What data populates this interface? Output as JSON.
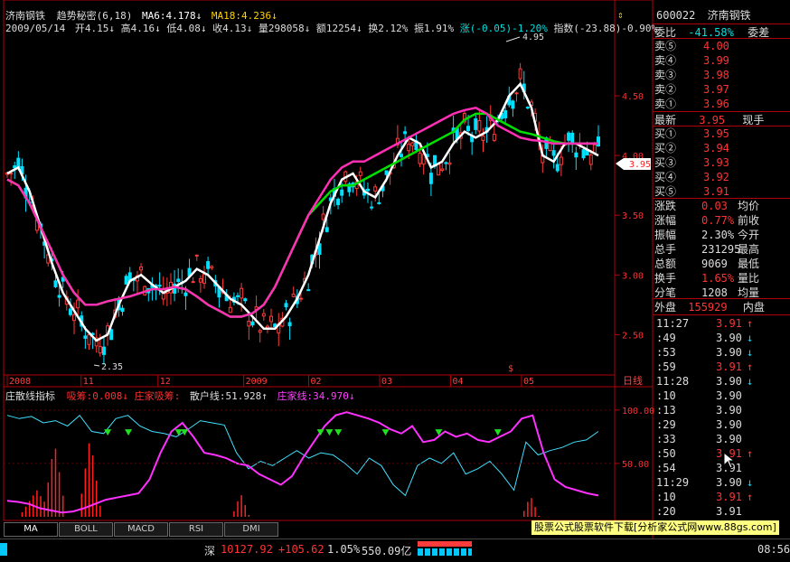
{
  "header": {
    "stock_name": "济南钢铁",
    "indicator_name": "趋势秘密(6,18)",
    "ma6": "MA6:4.178↓",
    "ma18": "MA18:4.236↓",
    "date": "2009/05/14",
    "open": "开4.15↓",
    "high": "高4.16↓",
    "low": "低4.08↓",
    "close": "收4.13↓",
    "volume": "量298058↓",
    "amount": "额12254↓",
    "turnover": "换2.12%",
    "amplitude": "振1.91%",
    "change": "涨(-0.05)-1.20%",
    "index": "指数(-23.88)-0.90%"
  },
  "price_axis": [
    "4.50",
    "4.00",
    "3.50",
    "3.00",
    "2.50"
  ],
  "current_price_tag": "3.95",
  "peak_label": "4.95",
  "trough_label": "2.35",
  "time_axis": [
    "2008",
    "11",
    "12",
    "2009",
    "02",
    "03",
    "04",
    "05"
  ],
  "sub_header": {
    "title": "庄散线指标",
    "accum": "吸筹:0.008↓",
    "dealer_accum": "庄家吸筹:",
    "retail_line": "散户线:51.928↑",
    "dealer_line": "庄家线:34.970↓"
  },
  "sub_axis": [
    "100.00",
    "50.00"
  ],
  "daily_label": "日线",
  "tabs": [
    "MA",
    "BOLL",
    "MACD",
    "RSI",
    "DMI"
  ],
  "watermark": "股票公式股票软件下载[分析家公式网www.88gs.com]",
  "status": {
    "market": "深",
    "index_value": "10127.92",
    "index_change": "+105.62",
    "index_pct": "1.05%",
    "turnover": "550.09亿",
    "time": "08:56"
  },
  "quote": {
    "code": "600022",
    "name": "济南钢铁",
    "commission_ratio_label": "委比",
    "commission_ratio": "-41.58%",
    "commission_diff_label": "委差",
    "asks": [
      {
        "label": "卖⑤",
        "price": "4.00"
      },
      {
        "label": "卖④",
        "price": "3.99"
      },
      {
        "label": "卖③",
        "price": "3.98"
      },
      {
        "label": "卖②",
        "price": "3.97"
      },
      {
        "label": "卖①",
        "price": "3.96"
      }
    ],
    "last_label": "最新",
    "last_price": "3.95",
    "last_vol_label": "现手",
    "bids": [
      {
        "label": "买①",
        "price": "3.95"
      },
      {
        "label": "买②",
        "price": "3.94"
      },
      {
        "label": "买③",
        "price": "3.93"
      },
      {
        "label": "买④",
        "price": "3.92"
      },
      {
        "label": "买⑤",
        "price": "3.91"
      }
    ],
    "stats": [
      {
        "label": "涨跌",
        "value": "0.03",
        "label2": "均价",
        "color": "#ff3333"
      },
      {
        "label": "涨幅",
        "value": "0.77%",
        "label2": "前收",
        "color": "#ff3333"
      },
      {
        "label": "振幅",
        "value": "2.30%",
        "label2": "今开",
        "color": "#dddddd"
      },
      {
        "label": "总手",
        "value": "231295",
        "label2": "最高",
        "color": "#dddddd"
      },
      {
        "label": "总额",
        "value": "9069",
        "label2": "最低",
        "color": "#dddddd"
      },
      {
        "label": "换手",
        "value": "1.65%",
        "label2": "量比",
        "color": "#ff3333"
      },
      {
        "label": "分笔",
        "value": "1208",
        "label2": "均量",
        "color": "#dddddd"
      }
    ],
    "outer_label": "外盘",
    "outer_value": "155929",
    "inner_label": "内盘"
  },
  "ticks": [
    {
      "time": "11:27",
      "price": "3.91",
      "dir": "up"
    },
    {
      "time": ":49",
      "price": "3.90",
      "dir": "down"
    },
    {
      "time": ":53",
      "price": "3.90",
      "dir": "down"
    },
    {
      "time": ":59",
      "price": "3.91",
      "dir": "up"
    },
    {
      "time": "11:28",
      "price": "3.90",
      "dir": "down"
    },
    {
      "time": ":10",
      "price": "3.90",
      "dir": ""
    },
    {
      "time": ":13",
      "price": "3.90",
      "dir": ""
    },
    {
      "time": ":29",
      "price": "3.90",
      "dir": ""
    },
    {
      "time": ":33",
      "price": "3.90",
      "dir": ""
    },
    {
      "time": ":50",
      "price": "3.91",
      "dir": "up"
    },
    {
      "time": ":54",
      "price": "3.91",
      "dir": ""
    },
    {
      "time": "11:29",
      "price": "3.90",
      "dir": "down"
    },
    {
      "time": ":10",
      "price": "3.91",
      "dir": "up"
    },
    {
      "time": ":20",
      "price": "3.91",
      "dir": ""
    }
  ],
  "chart_data": {
    "type": "line",
    "title": "济南钢铁 趋势秘密(6,18)",
    "ylim": [
      2.2,
      5.0
    ],
    "series": [
      {
        "name": "MA6",
        "color": "#ffffff",
        "values": [
          3.85,
          3.9,
          3.7,
          3.4,
          3.1,
          2.85,
          2.7,
          2.55,
          2.45,
          2.5,
          2.75,
          2.95,
          3.0,
          2.92,
          2.85,
          2.9,
          2.95,
          3.05,
          3.0,
          2.9,
          2.8,
          2.75,
          2.65,
          2.55,
          2.55,
          2.65,
          2.8,
          3.0,
          3.3,
          3.6,
          3.8,
          3.85,
          3.7,
          3.65,
          3.8,
          4.0,
          4.15,
          4.1,
          3.9,
          3.95,
          4.1,
          4.2,
          4.15,
          4.2,
          4.3,
          4.5,
          4.6,
          4.4,
          4.0,
          3.95,
          4.1,
          4.1,
          4.05,
          4.0
        ]
      },
      {
        "name": "MA18",
        "color": "#00e000",
        "values": [
          3.8,
          3.75,
          3.6,
          3.4,
          3.2,
          3.0,
          2.85,
          2.75,
          2.75,
          2.78,
          2.8,
          2.82,
          2.85,
          2.88,
          2.88,
          2.9,
          2.88,
          2.82,
          2.75,
          2.7,
          2.65,
          2.65,
          2.68,
          2.75,
          2.9,
          3.1,
          3.3,
          3.5,
          3.6,
          3.7,
          3.75,
          3.75,
          3.8,
          3.85,
          3.9,
          3.95,
          4.0,
          4.05,
          4.1,
          4.15,
          4.2,
          4.3,
          4.35,
          4.35,
          4.3,
          4.25,
          4.2,
          4.18,
          4.15,
          4.12,
          4.1,
          4.1,
          4.1,
          4.1
        ]
      },
      {
        "name": "trend",
        "color": "#ff2fb5",
        "values": [
          3.8,
          3.75,
          3.6,
          3.4,
          3.2,
          3.0,
          2.85,
          2.75,
          2.75,
          2.78,
          2.8,
          2.82,
          2.85,
          2.88,
          2.88,
          2.9,
          2.88,
          2.82,
          2.75,
          2.7,
          2.65,
          2.65,
          2.68,
          2.75,
          2.9,
          3.1,
          3.3,
          3.5,
          3.65,
          3.8,
          3.9,
          3.95,
          3.95,
          4.0,
          4.05,
          4.1,
          4.15,
          4.2,
          4.25,
          4.3,
          4.35,
          4.38,
          4.4,
          4.35,
          4.25,
          4.2,
          4.15,
          4.13,
          4.12,
          4.1,
          4.1,
          4.1,
          4.1,
          4.1
        ]
      }
    ],
    "sub_chart": {
      "ylim": [
        0,
        110
      ],
      "retail_line": [
        95,
        92,
        94,
        88,
        90,
        85,
        95,
        80,
        78,
        92,
        95,
        85,
        80,
        78,
        75,
        82,
        90,
        88,
        86,
        60,
        45,
        52,
        48,
        55,
        62,
        55,
        60,
        58,
        50,
        40,
        55,
        48,
        30,
        20,
        48,
        55,
        50,
        60,
        40,
        45,
        52,
        40,
        25,
        70,
        58,
        62,
        65,
        70,
        72,
        80
      ],
      "dealer_line": [
        15,
        14,
        12,
        8,
        6,
        4,
        5,
        8,
        12,
        16,
        18,
        20,
        22,
        35,
        60,
        80,
        88,
        75,
        60,
        58,
        55,
        50,
        48,
        40,
        35,
        30,
        38,
        55,
        70,
        85,
        95,
        98,
        95,
        92,
        88,
        82,
        78,
        85,
        70,
        72,
        80,
        75,
        78,
        72,
        70,
        75,
        80,
        92,
        95,
        60,
        35,
        28,
        25,
        22,
        20
      ]
    }
  }
}
